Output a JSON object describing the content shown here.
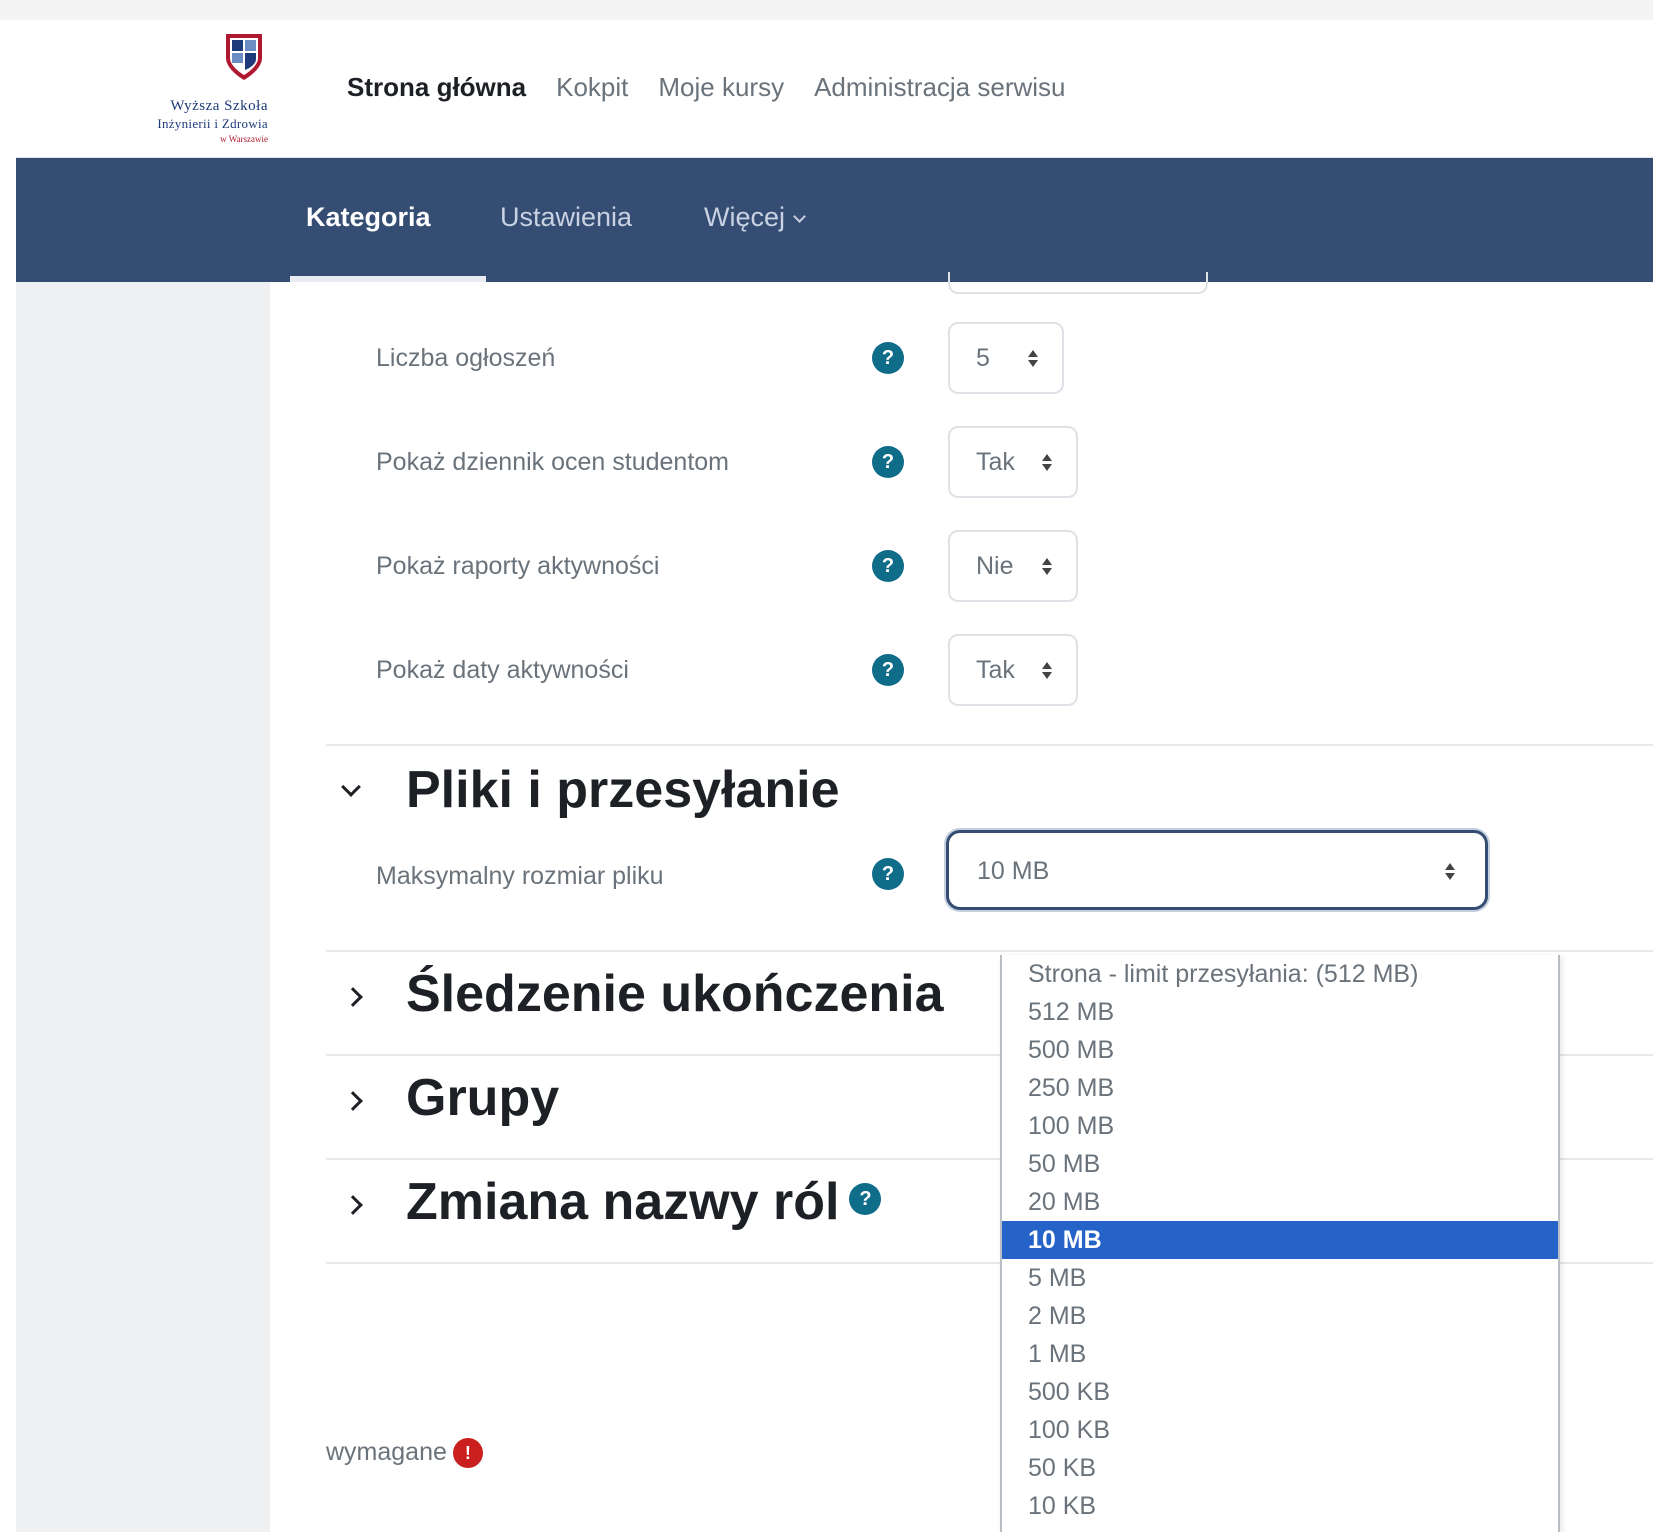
{
  "logo": {
    "line1": "Wyższa Szkoła",
    "line2": "Inżynierii i Zdrowia",
    "line3": "w Warszawie",
    "colors": {
      "navy": "#1e3a7a",
      "red": "#b0182f"
    }
  },
  "primary_nav": [
    {
      "label": "Strona główna",
      "active": true
    },
    {
      "label": "Kokpit",
      "active": false
    },
    {
      "label": "Moje kursy",
      "active": false
    },
    {
      "label": "Administracja serwisu",
      "active": false
    }
  ],
  "secondary_nav": {
    "tabs": [
      {
        "label": "Kategoria",
        "active": true
      },
      {
        "label": "Ustawienia",
        "active": false
      },
      {
        "label": "Więcej",
        "active": false,
        "icon": "chevron-down-icon"
      }
    ],
    "background": "#364d73"
  },
  "settings": [
    {
      "label": "Liczba ogłoszeń",
      "value": "5",
      "help_icon": "question-icon"
    },
    {
      "label": "Pokaż dziennik ocen studentom",
      "value": "Tak",
      "help_icon": "question-icon"
    },
    {
      "label": "Pokaż raporty aktywności",
      "value": "Nie",
      "help_icon": "question-icon"
    },
    {
      "label": "Pokaż daty aktywności",
      "value": "Tak",
      "help_icon": "question-icon"
    }
  ],
  "sections": {
    "files": {
      "title": "Pliki i przesyłanie",
      "expanded": true
    },
    "completion": {
      "title": "Śledzenie ukończenia",
      "expanded": false
    },
    "groups": {
      "title": "Grupy",
      "expanded": false
    },
    "roles": {
      "title": "Zmiana nazwy ról",
      "expanded": false,
      "help_icon": "question-icon"
    }
  },
  "max_file_size": {
    "label": "Maksymalny rozmiar pliku",
    "value": "10 MB",
    "options": [
      "Strona - limit przesyłania: (512 MB)",
      "512 MB",
      "500 MB",
      "250 MB",
      "100 MB",
      "50 MB",
      "20 MB",
      "10 MB",
      "5 MB",
      "2 MB",
      "1 MB",
      "500 KB",
      "100 KB",
      "50 KB",
      "10 KB"
    ],
    "selected_option": "10 MB"
  },
  "required_note": {
    "label": "wymagane",
    "icon": "exclamation-icon"
  },
  "colors": {
    "help_icon": "#0f6d8a",
    "selected_option": "#2563c9",
    "required_icon": "#c9201f"
  }
}
